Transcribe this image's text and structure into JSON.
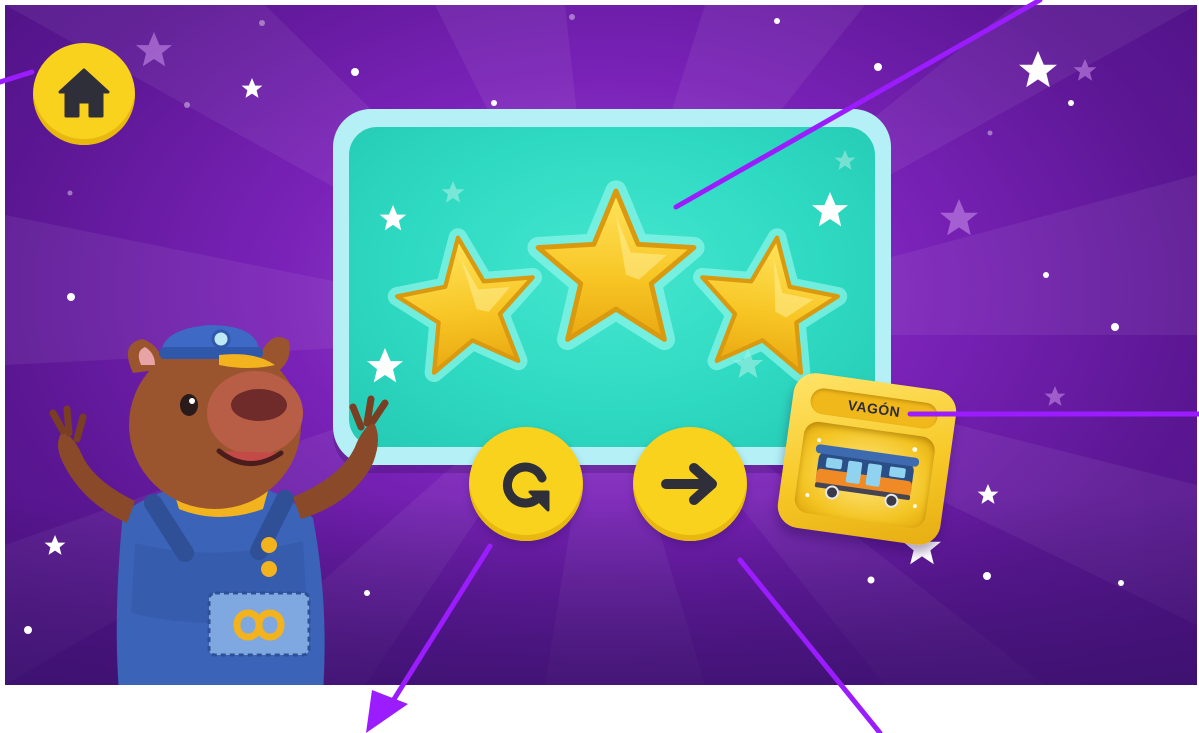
{
  "reward_card": {
    "title": "VAGÓN",
    "item_icon": "train-wagon-icon"
  },
  "result": {
    "stars_earned": 3,
    "stars_total": 3,
    "star_color": "#f7c524"
  },
  "buttons": {
    "home_icon": "home-icon",
    "replay_icon": "replay-icon",
    "next_icon": "arrow-right-icon"
  },
  "colors": {
    "background": "#7a22b8",
    "panel_outer": "#b4f0f6",
    "panel_inner": "#2fdac2",
    "button_yellow": "#f8d21d",
    "annotation_line": "#9b1cff"
  }
}
